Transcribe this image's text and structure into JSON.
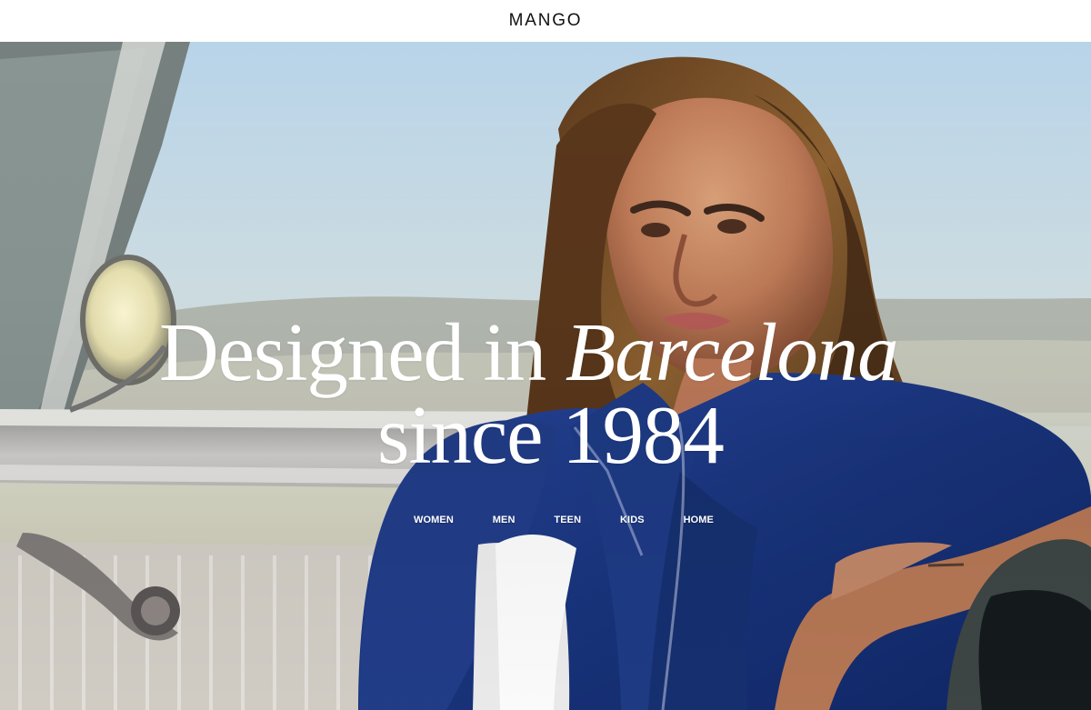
{
  "header": {
    "logo": "MANGO"
  },
  "hero": {
    "headline_prefix": "Designed in ",
    "headline_emphasis": "Barcelona",
    "headline_line_two": "since 1984",
    "nav_items": [
      {
        "label": "WOMEN"
      },
      {
        "label": "MEN"
      },
      {
        "label": "TEEN"
      },
      {
        "label": "KIDS"
      },
      {
        "label": "HOME"
      }
    ]
  },
  "colors": {
    "text": "#ffffff",
    "logo": "#111111",
    "jacket": "#1f3b8f",
    "sky": "#cfe0e7"
  }
}
